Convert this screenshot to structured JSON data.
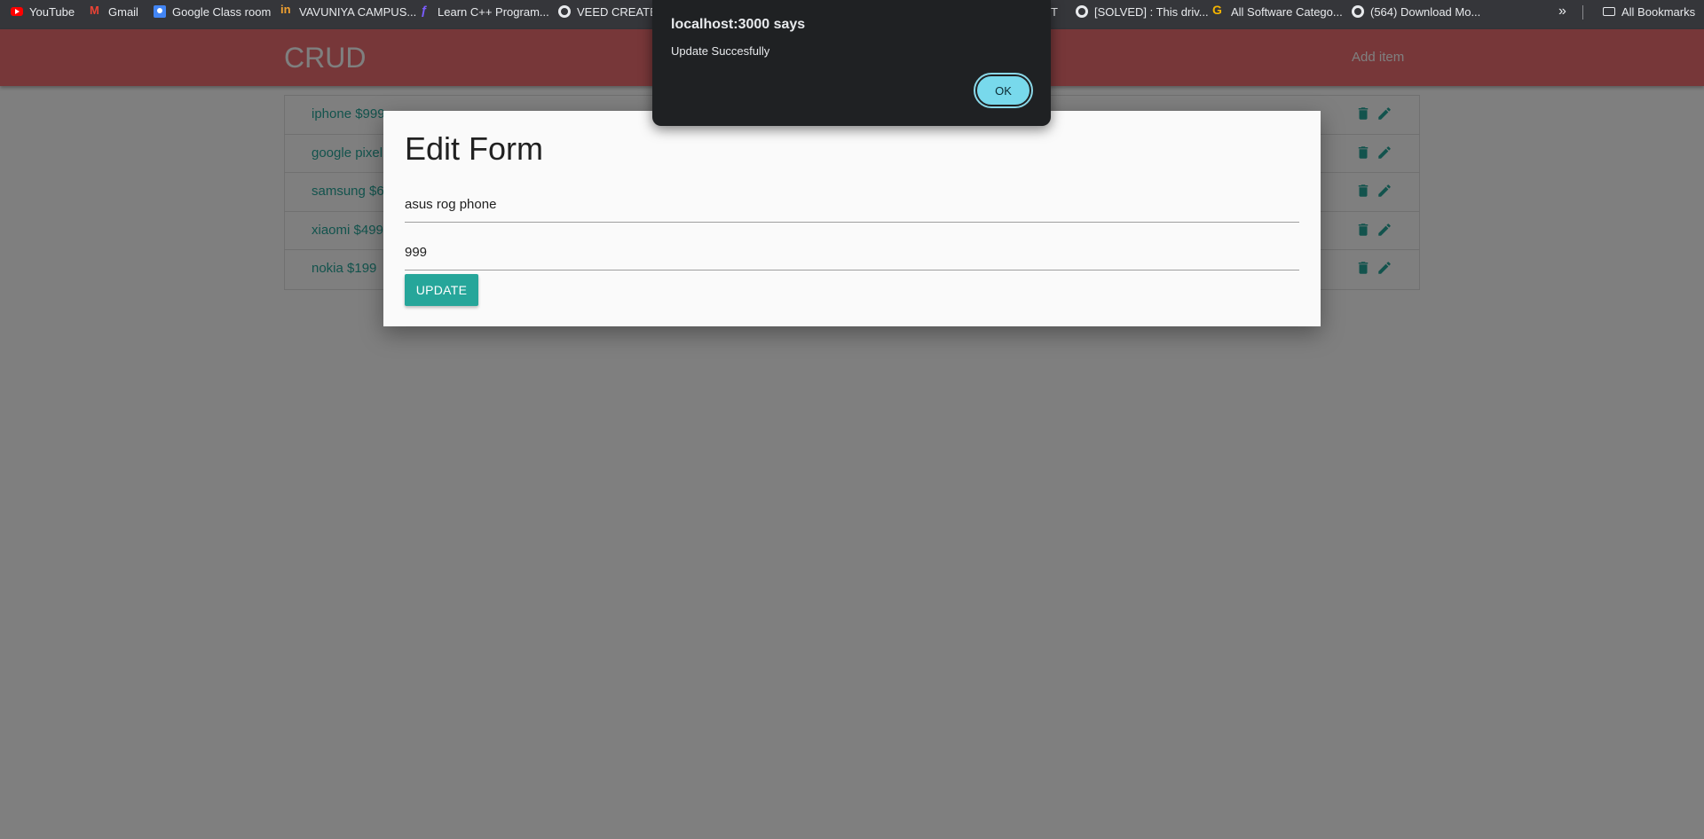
{
  "bookmarks": [
    {
      "label": "YouTube",
      "icon": "youtube-icon"
    },
    {
      "label": "Gmail",
      "icon": "gmail-icon"
    },
    {
      "label": "Google Class room",
      "icon": "google-classroom-icon"
    },
    {
      "label": "VAVUNIYA CAMPUS...",
      "icon": "campus-icon"
    },
    {
      "label": "Learn C++ Program...",
      "icon": "cpp-icon"
    },
    {
      "label": "VEED CREATE | I",
      "icon": "globe-icon"
    },
    {
      "label": "[SOLVED] : This driv...",
      "icon": "globe-icon"
    },
    {
      "label": "All Software Catego...",
      "icon": "g-icon"
    },
    {
      "label": "(564) Download Mo...",
      "icon": "globe-icon"
    }
  ],
  "bookmarks_more": "»",
  "bookmarks_folder": "All Bookmarks",
  "bookmark_fragment": "T",
  "app": {
    "brand": "CRUD",
    "nav_add": "Add item"
  },
  "items": [
    {
      "text": "iphone $999"
    },
    {
      "text": "google pixel"
    },
    {
      "text": "samsung $6"
    },
    {
      "text": "xiaomi $499"
    },
    {
      "text": "nokia $199"
    }
  ],
  "modal": {
    "title": "Edit Form",
    "name_value": "asus rog phone",
    "price_value": "999",
    "update_label": "UPDATE"
  },
  "alert": {
    "title": "localhost:3000 says",
    "message": "Update Succesfully",
    "ok_label": "OK"
  },
  "colors": {
    "navbar": "#ee6e73",
    "accent": "#26a69a",
    "alert_bg": "#1f2123",
    "ok_button": "#78d9ec"
  }
}
